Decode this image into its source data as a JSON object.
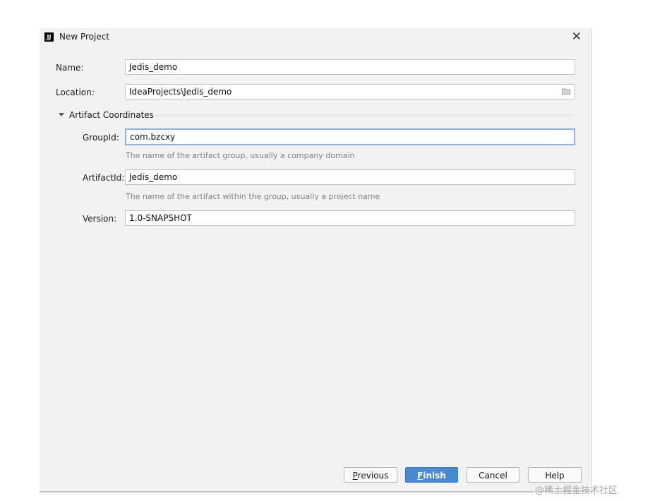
{
  "window": {
    "title": "New Project",
    "app_icon": "intellij-idea-icon",
    "close_symbol": "✕"
  },
  "form": {
    "name_label": "Name:",
    "name_value": "Jedis_demo",
    "location_label": "Location:",
    "location_value": "IdeaProjects\\Jedis_demo",
    "section_title": "Artifact Coordinates",
    "groupid_label": "GroupId:",
    "groupid_value": "com.bzcxy",
    "groupid_hint": "The name of the artifact group, usually a company domain",
    "artifactid_label": "ArtifactId:",
    "artifactid_value": "Jedis_demo",
    "artifactid_hint": "The name of the artifact within the group, usually a project name",
    "version_label": "Version:",
    "version_value": "1.0-SNAPSHOT"
  },
  "buttons": {
    "previous_mnemonic": "P",
    "previous_rest": "revious",
    "finish_mnemonic": "F",
    "finish_rest": "inish",
    "cancel": "Cancel",
    "help": "Help"
  },
  "watermark": "@稀土掘金技术社区",
  "colors": {
    "accent": "#4a8ad2",
    "focus_border": "#8db3da",
    "dialog_bg": "#f2f2f2"
  }
}
